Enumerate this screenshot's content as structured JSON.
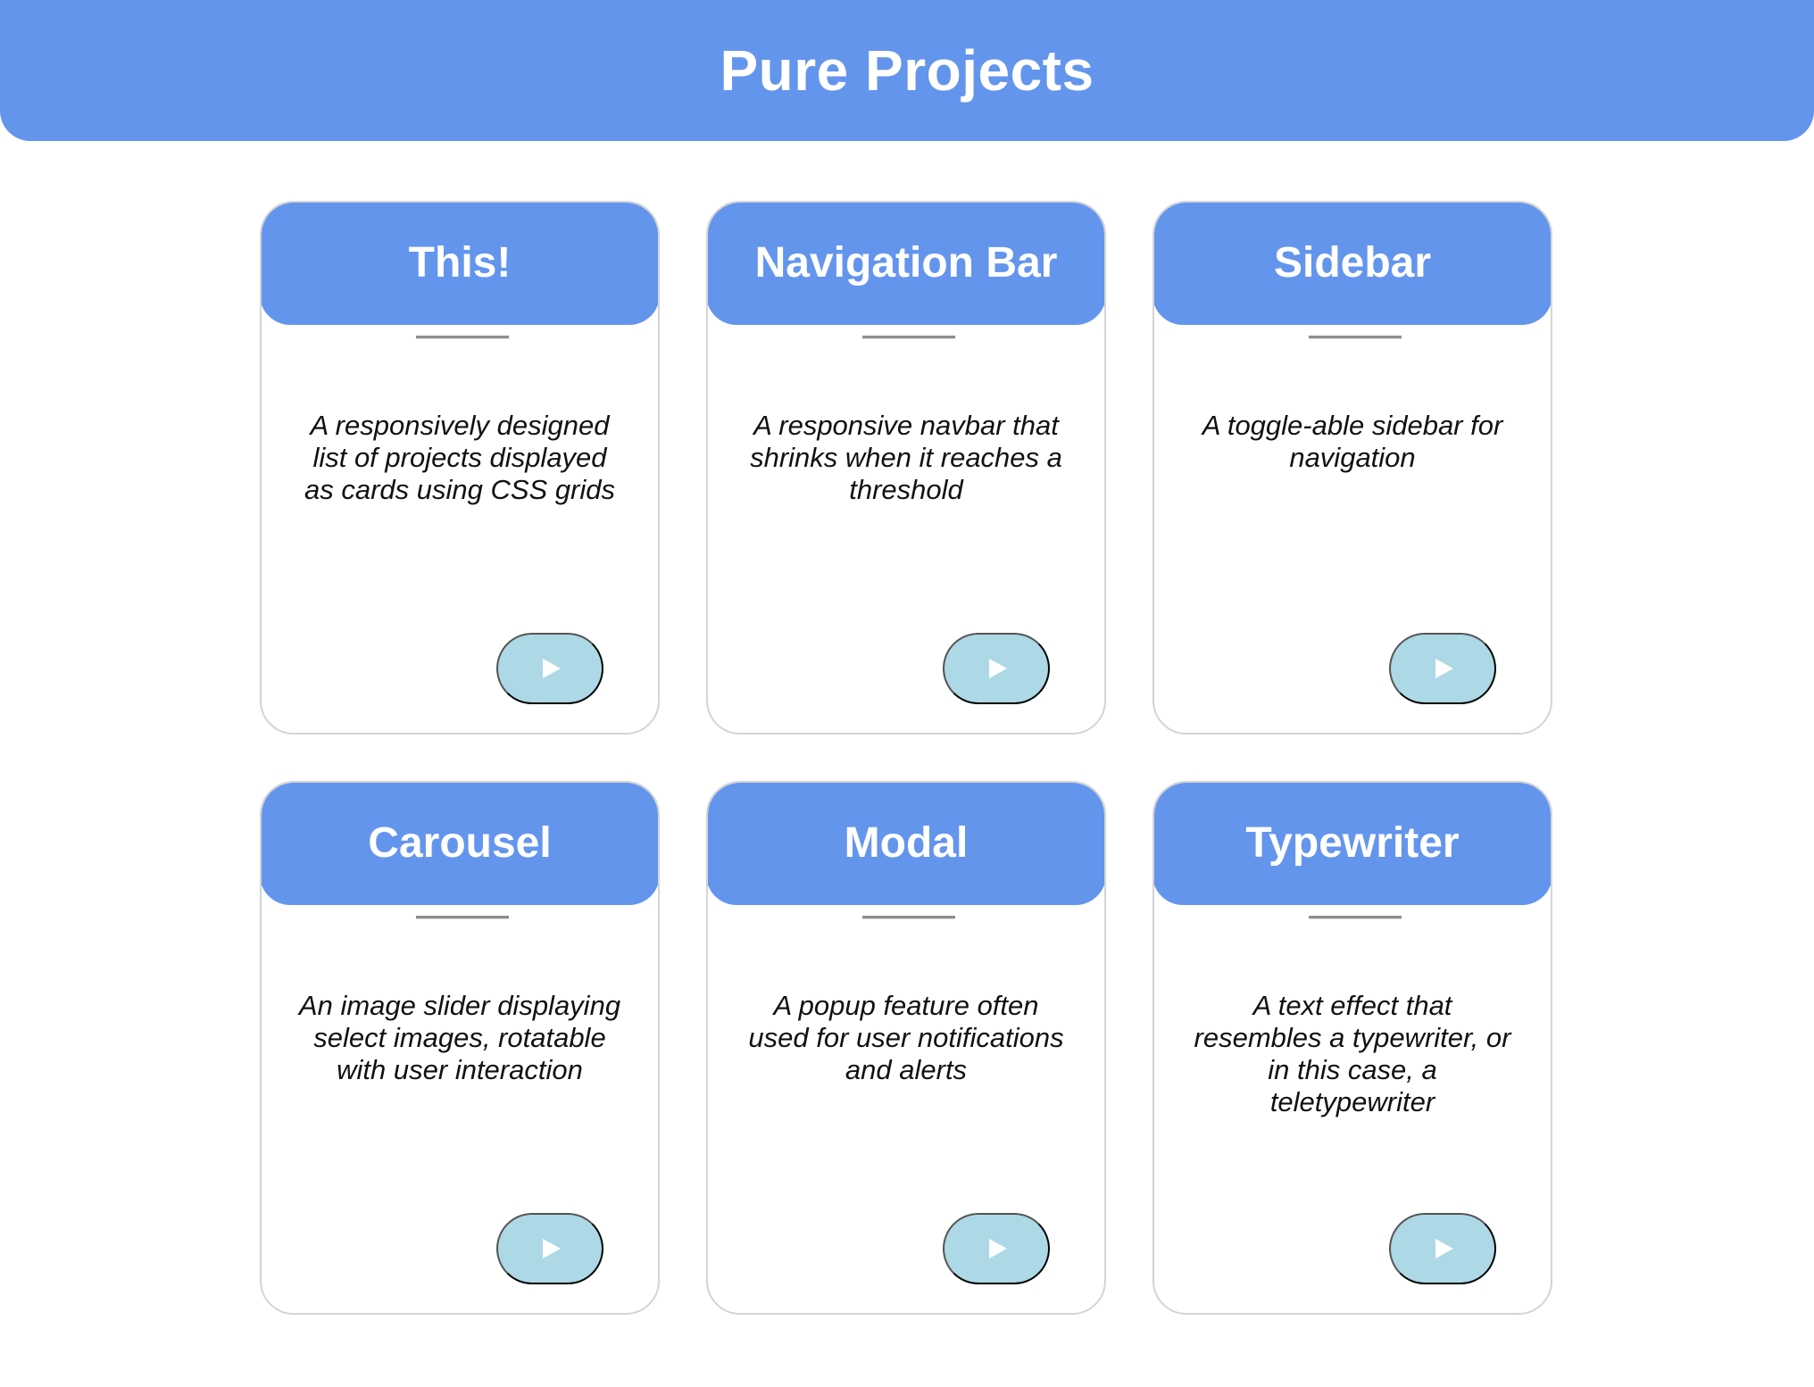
{
  "header": {
    "title": "Pure Projects"
  },
  "projects": [
    {
      "title": "This!",
      "description": "A responsively designed list of projects displayed as cards using CSS grids",
      "button_icon": "play-icon"
    },
    {
      "title": "Navigation Bar",
      "description": "A responsive navbar that shrinks when it reaches a threshold",
      "button_icon": "play-icon"
    },
    {
      "title": "Sidebar",
      "description": "A toggle-able sidebar for navigation",
      "button_icon": "play-icon"
    },
    {
      "title": "Carousel",
      "description": "An image slider displaying select images, rotatable with user interaction",
      "button_icon": "play-icon"
    },
    {
      "title": "Modal",
      "description": "A popup feature often used for user notifications and alerts",
      "button_icon": "play-icon"
    },
    {
      "title": "Typewriter",
      "description": "A text effect that resembles a typewriter, or in this case, a teletypewriter",
      "button_icon": "play-icon"
    }
  ],
  "colors": {
    "header_background": "#6495ed",
    "card_header_background": "#6495ed",
    "button_background": "#add8e6",
    "card_border": "#d4d4d4"
  }
}
